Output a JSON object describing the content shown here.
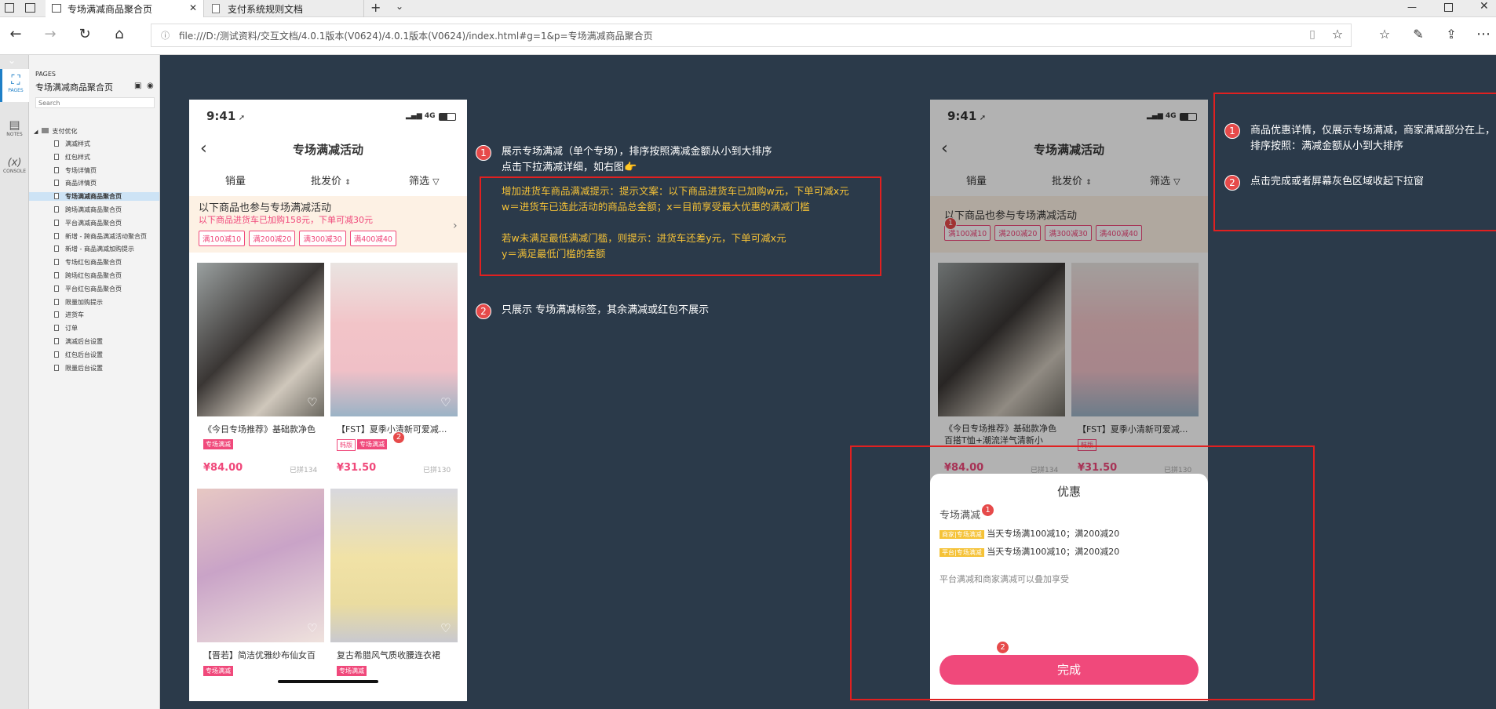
{
  "browser": {
    "tabs": [
      {
        "title": "专场满减商品聚合页"
      },
      {
        "title": "支付系统规则文档"
      }
    ],
    "url": "file:///D:/测试资料/交互文档/4.0.1版本(V0624)/4.0.1版本(V0624)/index.html#g=1&p=专场满减商品聚合页"
  },
  "iconstrip": {
    "pages": "PAGES",
    "notes": "NOTES",
    "console": "CONSOLE"
  },
  "sitemap": {
    "header": "PAGES",
    "title": "专场满减商品聚合页",
    "search_placeholder": "Search",
    "folder": "支付优化",
    "items": [
      "满减样式",
      "红包样式",
      "专场详情页",
      "商品详情页",
      "专场满减商品聚合页",
      "跨场满减商品聚合页",
      "平台满减商品聚合页",
      "新增 - 跨商品满减活动聚合页",
      "新增 - 商品满减加购提示",
      "专场红包商品聚合页",
      "跨场红包商品聚合页",
      "平台红包商品聚合页",
      "限量加购提示",
      "进货车",
      "订单",
      "满减后台设置",
      "红包后台设置",
      "限量后台设置"
    ],
    "active_index": 4
  },
  "phone_left": {
    "time": "9:41",
    "network": "4G",
    "title": "专场满减活动",
    "sort": [
      "销量",
      "批发价",
      "筛选"
    ],
    "banner_title": "以下商品也参与专场满减活动",
    "banner_hint": "以下商品进货车已加购158元，下单可减30元",
    "chips": [
      "满100减10",
      "满200减20",
      "满300减30",
      "满400减40"
    ],
    "products": [
      {
        "name": "《今日专场推荐》基础款净色",
        "tags": [
          "专场满减"
        ],
        "price": "¥84.00",
        "sold": "已拼134"
      },
      {
        "name": "【FST】夏季小清新可爱减...",
        "tags": [
          "韩版",
          "专场满减"
        ],
        "price": "¥31.50",
        "sold": "已拼130"
      },
      {
        "name": "【晋若】简洁优雅纱布仙女百",
        "tags": [
          "专场满减"
        ]
      },
      {
        "name": "复古希腊风气质收腰连衣裙",
        "tags": [
          "专场满减"
        ]
      }
    ]
  },
  "notes_middle": {
    "n1": "1",
    "line1": "展示专场满减（单个专场），排序按照满减金额从小到大排序",
    "line2": "点击下拉满减详细，如右图👉",
    "y1": "增加进货车商品满减提示：提示文案：以下商品进货车已加购w元，下单可减x元",
    "y2": "w＝进货车已选此活动的商品总金额；x＝目前享受最大优惠的满减门槛",
    "y3": "若w未满足最低满减门槛，则提示：进货车还差y元，下单可减x元",
    "y4": "y＝满足最低门槛的差额",
    "n2": "2",
    "line3": "只展示 专场满减标签，其余满减或红包不展示",
    "badge_2": "2"
  },
  "phone_right": {
    "time": "9:41",
    "network": "4G",
    "title": "专场满减活动",
    "sort": [
      "销量",
      "批发价",
      "筛选"
    ],
    "banner_title": "以下商品也参与专场满减活动",
    "chips": [
      "满100减10",
      "满200减20",
      "满300减30",
      "满400减40"
    ],
    "badge_1": "1",
    "products": [
      {
        "name": "《今日专场推荐》基础款净色百搭T恤+潮流洋气清新小",
        "price": "¥84.00",
        "sold": "已拼134"
      },
      {
        "name": "【FST】夏季小清新可爱减...",
        "tag": "韩版",
        "price": "¥31.50",
        "sold": "已拼130"
      }
    ],
    "sheet": {
      "title": "优惠",
      "section": "专场满减",
      "badge_1": "1",
      "rows": [
        {
          "tag": "商家|专场满减",
          "text": "当天专场满100减10；满200减20"
        },
        {
          "tag": "平台|专场满减",
          "text": "当天专场满100减10；满200减20"
        }
      ],
      "note": "平台满减和商家满减可以叠加享受",
      "badge_2": "2",
      "button": "完成"
    }
  },
  "notes_right": {
    "n1": "1",
    "line1": "商品优惠详情，仅展示专场满减，商家满减部分在上，",
    "line2": "排序按照：满减金额从小到大排序",
    "n2": "2",
    "line3": "点击完成或者屏幕灰色区域收起下拉窗"
  },
  "colors": {
    "accent": "#f0497b",
    "canvas": "#2b3a4a",
    "annotation_red": "#e12020",
    "note_yellow": "#f5c237"
  }
}
